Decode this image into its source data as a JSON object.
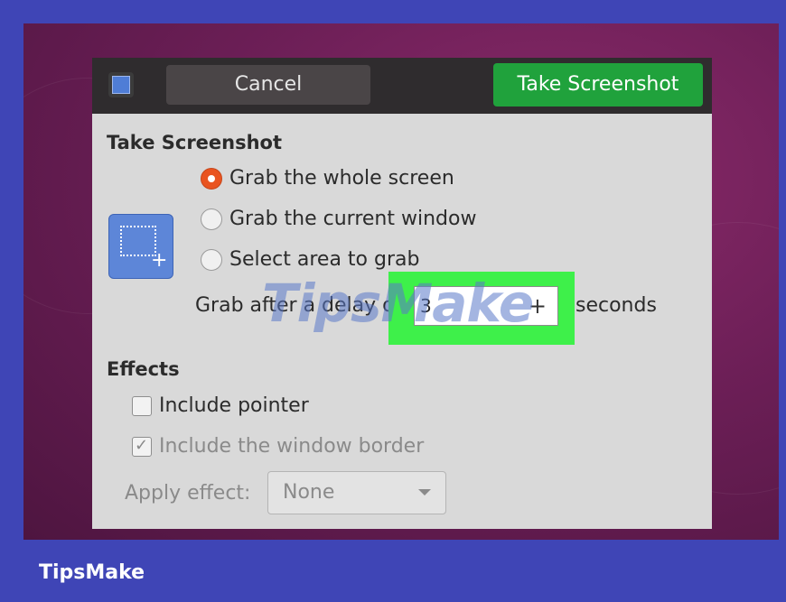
{
  "header": {
    "cancel_label": "Cancel",
    "take_label": "Take Screenshot"
  },
  "capture": {
    "title": "Take Screenshot",
    "options": [
      {
        "label": "Grab the whole screen",
        "selected": true
      },
      {
        "label": "Grab the current window",
        "selected": false
      },
      {
        "label": "Select area to grab",
        "selected": false
      }
    ],
    "delay_label": "Grab after a delay of",
    "delay_value": "3",
    "delay_units": "seconds"
  },
  "effects": {
    "title": "Effects",
    "include_pointer": {
      "label": "Include pointer",
      "checked": false
    },
    "include_border": {
      "label": "Include the window border",
      "checked": true
    },
    "apply_effect_label": "Apply effect:",
    "apply_effect_value": "None"
  },
  "watermark": "TipsMake",
  "brand": "TipsMake",
  "colors": {
    "outer_frame": "#3f45b6",
    "take_button": "#20a23c",
    "radio_selected": "#e95420",
    "highlight": "#3ef04a"
  },
  "icons": {
    "app": "screenshot-app-icon",
    "capture": "area-selection-icon",
    "spin_plus": "plus-icon",
    "dropdown": "chevron-down-icon"
  }
}
